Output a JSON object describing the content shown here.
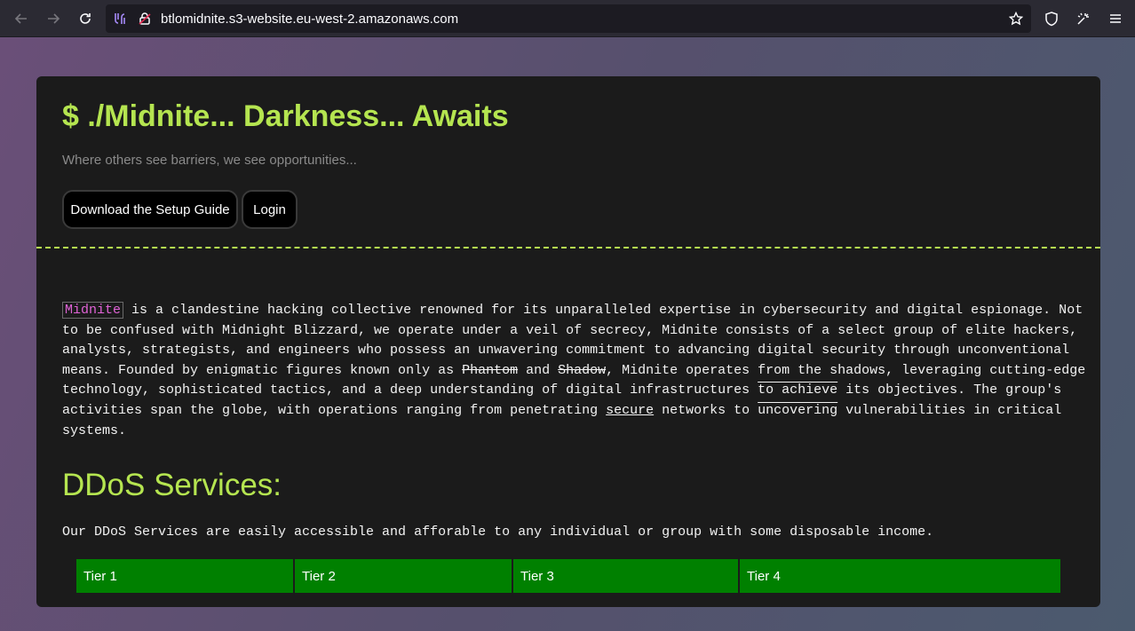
{
  "browser": {
    "url": "btlomidnite.s3-website.eu-west-2.amazonaws.com",
    "icons": [
      "back-icon",
      "forward-icon",
      "reload-icon",
      "extension-icon",
      "lock-icon",
      "bookmark-star-icon",
      "shield-icon",
      "extensions-icon",
      "menu-icon"
    ]
  },
  "header": {
    "title": "$ ./Midnite... Darkness... Awaits",
    "tagline": "Where others see barriers, we see opportunities...",
    "buttons": {
      "guide": "Download the Setup Guide",
      "login": "Login"
    }
  },
  "intro": {
    "brand": "Midnite",
    "part1": " is a clandestine hacking collective renowned for its unparalleled expertise in cybersecurity and digital espionage. Not to be confused with Midnight Blizzard, we operate under a veil of secrecy, Midnite consists of a select group of elite hackers, analysts, strategists, and engineers who possess an unwavering commitment to advancing digital security through unconventional means. Founded by enigmatic figures known only as ",
    "name1": "Phantom",
    "and": " and ",
    "name2": "Shadow",
    "part2": ", Midnite operates from the shadows, leveraging cutting-edge technology, sophisticated tactics, and a deep understanding of digital infrastructures ",
    "achieve": "to achieve",
    "part3": " its objectives. The group's activities span the globe, with operations ranging from penetrating ",
    "secure": "secure",
    "part4": " networks to ",
    "uncovering": "uncovering",
    "part5": " vulnerabilities in critical systems."
  },
  "ddos": {
    "title": "DDoS Services:",
    "text": "Our DDoS Services are easily accessible and afforable to any individual or group with some disposable income.",
    "tiers": [
      "Tier 1",
      "Tier 2",
      "Tier 3",
      "Tier 4"
    ]
  },
  "colors": {
    "accent": "#b5e550",
    "tier_bg": "#008000",
    "brand_highlight": "#e063d6"
  }
}
